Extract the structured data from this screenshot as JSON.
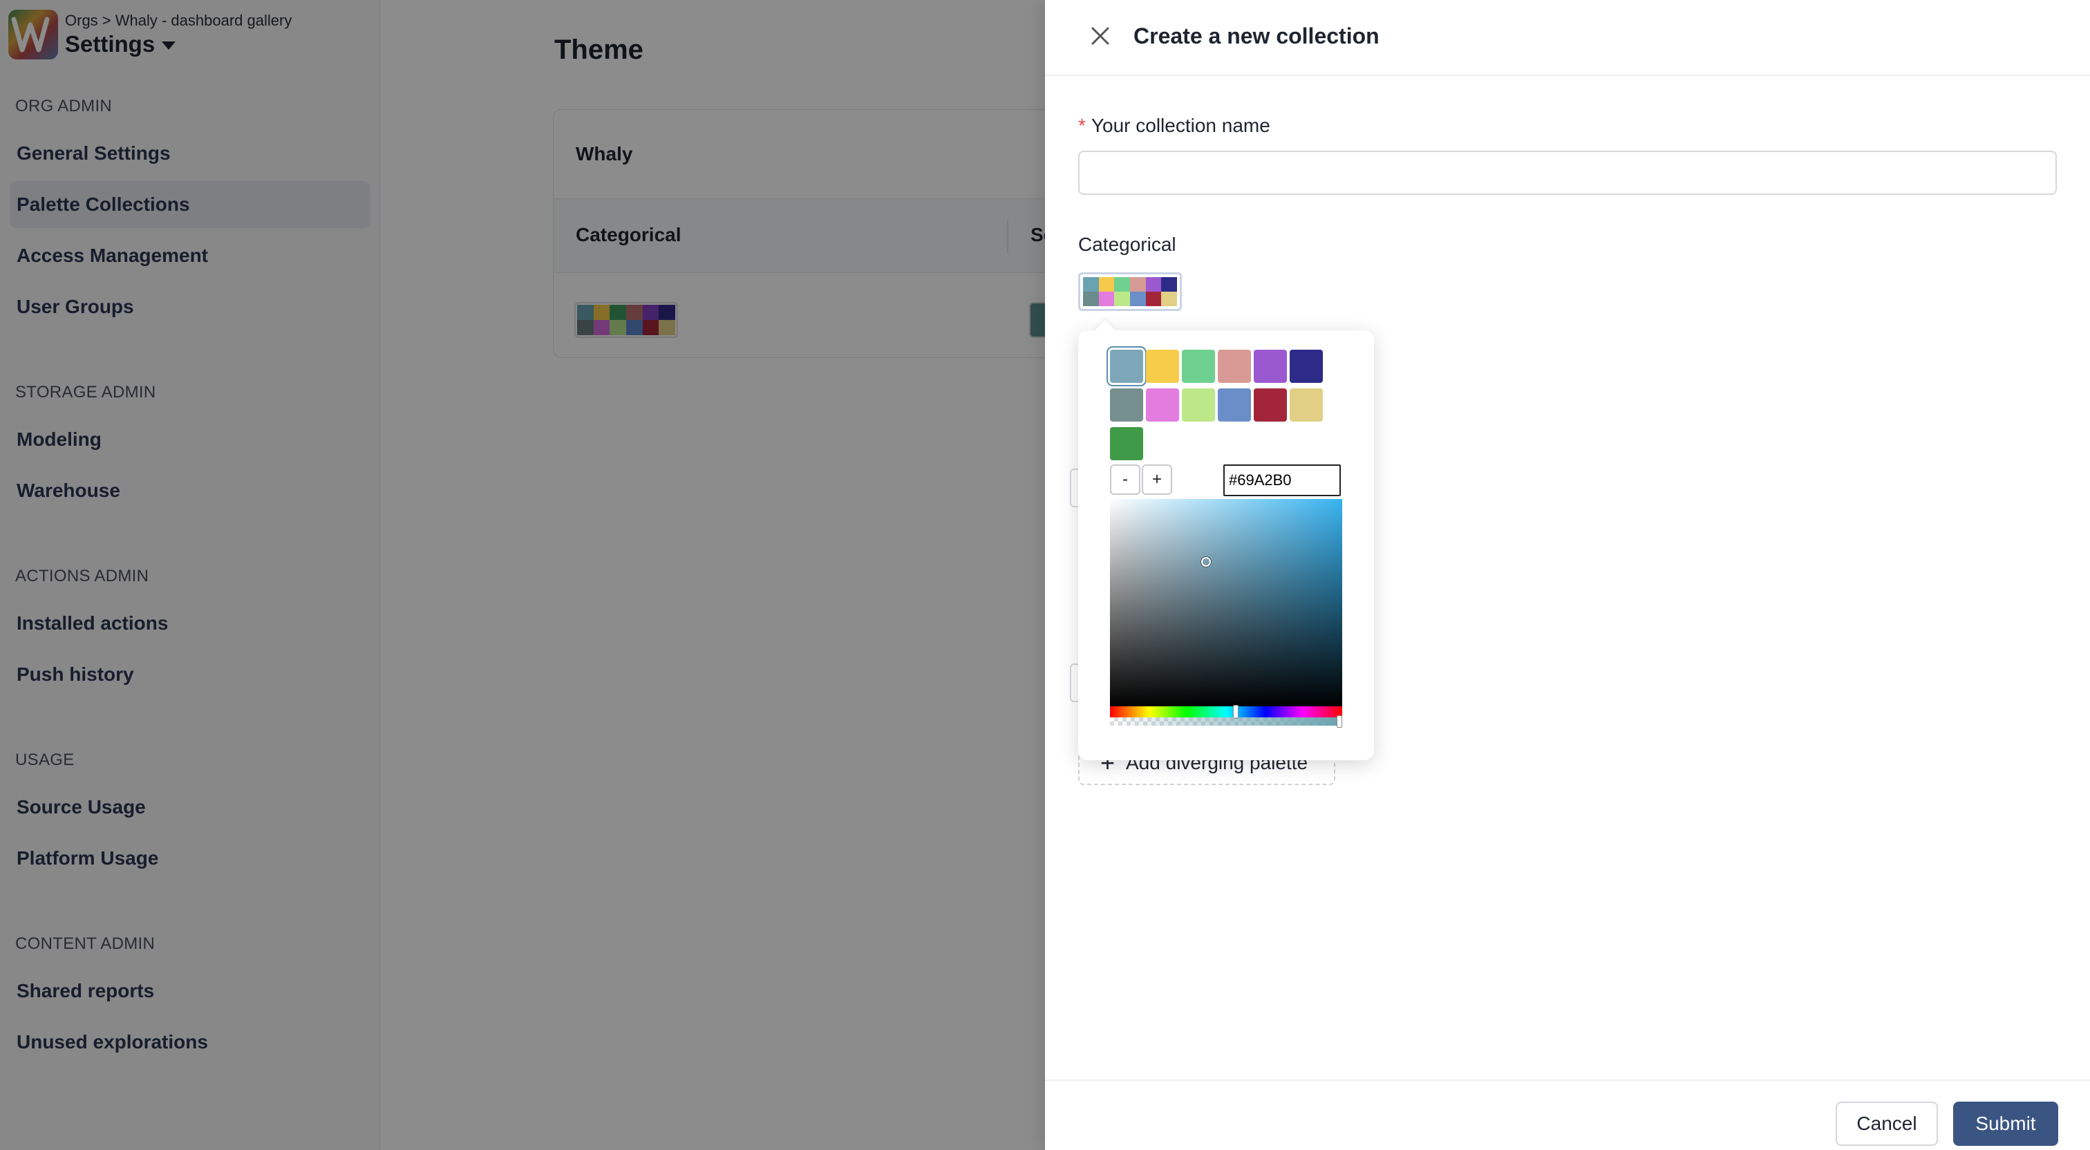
{
  "sidebar": {
    "breadcrumb": "Orgs > Whaly - dashboard gallery",
    "title": "Settings",
    "sections": [
      {
        "title": "ORG ADMIN",
        "items": [
          "General Settings",
          "Palette Collections",
          "Access Management",
          "User Groups"
        ]
      },
      {
        "title": "STORAGE ADMIN",
        "items": [
          "Modeling",
          "Warehouse"
        ]
      },
      {
        "title": "ACTIONS ADMIN",
        "items": [
          "Installed actions",
          "Push history"
        ]
      },
      {
        "title": "USAGE",
        "items": [
          "Source Usage",
          "Platform Usage"
        ]
      },
      {
        "title": "CONTENT ADMIN",
        "items": [
          "Shared reports",
          "Unused explorations"
        ]
      }
    ],
    "active_item": "Palette Collections"
  },
  "main": {
    "title": "Theme",
    "card": {
      "name": "Whaly",
      "columns": [
        "Categorical",
        "Se"
      ],
      "palette_colors": [
        "#69a2b0",
        "#f6c94a",
        "#3f9a5e",
        "#b96d6d",
        "#7f3fbf",
        "#2e2a88",
        "#6b7b7b",
        "#d36ad9",
        "#b6e08a",
        "#5b84c8",
        "#a3253a",
        "#e0cf85"
      ]
    }
  },
  "drawer": {
    "title": "Create a new collection",
    "name_label": "Your collection name",
    "name_required_mark": "*",
    "name_value": "",
    "categorical_label": "Categorical",
    "add_diverging_label": "Add diverging palette",
    "cancel_label": "Cancel",
    "submit_label": "Submit",
    "palette_colors": [
      "#69a2b0",
      "#f6c94a",
      "#6fd08f",
      "#d79a95",
      "#9b59d0",
      "#2e2a88",
      "#6b8c8c",
      "#e27cde",
      "#bde88a",
      "#6a8fc8",
      "#a3253a",
      "#e0cf85"
    ]
  },
  "color_picker": {
    "swatches": [
      "#7da7b8",
      "#f6cd4a",
      "#6ed08f",
      "#d99a95",
      "#9b59d0",
      "#2e2a88",
      "#758f8f",
      "#e27cde",
      "#bde88a",
      "#6a8fc8",
      "#a3253a",
      "#e0cf85",
      "#3f9a47"
    ],
    "selected_index": 0,
    "minus_label": "-",
    "plus_label": "+",
    "hex_value": "#69A2B0"
  },
  "colors": {
    "accent": "#3b5583",
    "overlay": "rgba(0,0,0,0.45)",
    "required": "#e5484d"
  }
}
